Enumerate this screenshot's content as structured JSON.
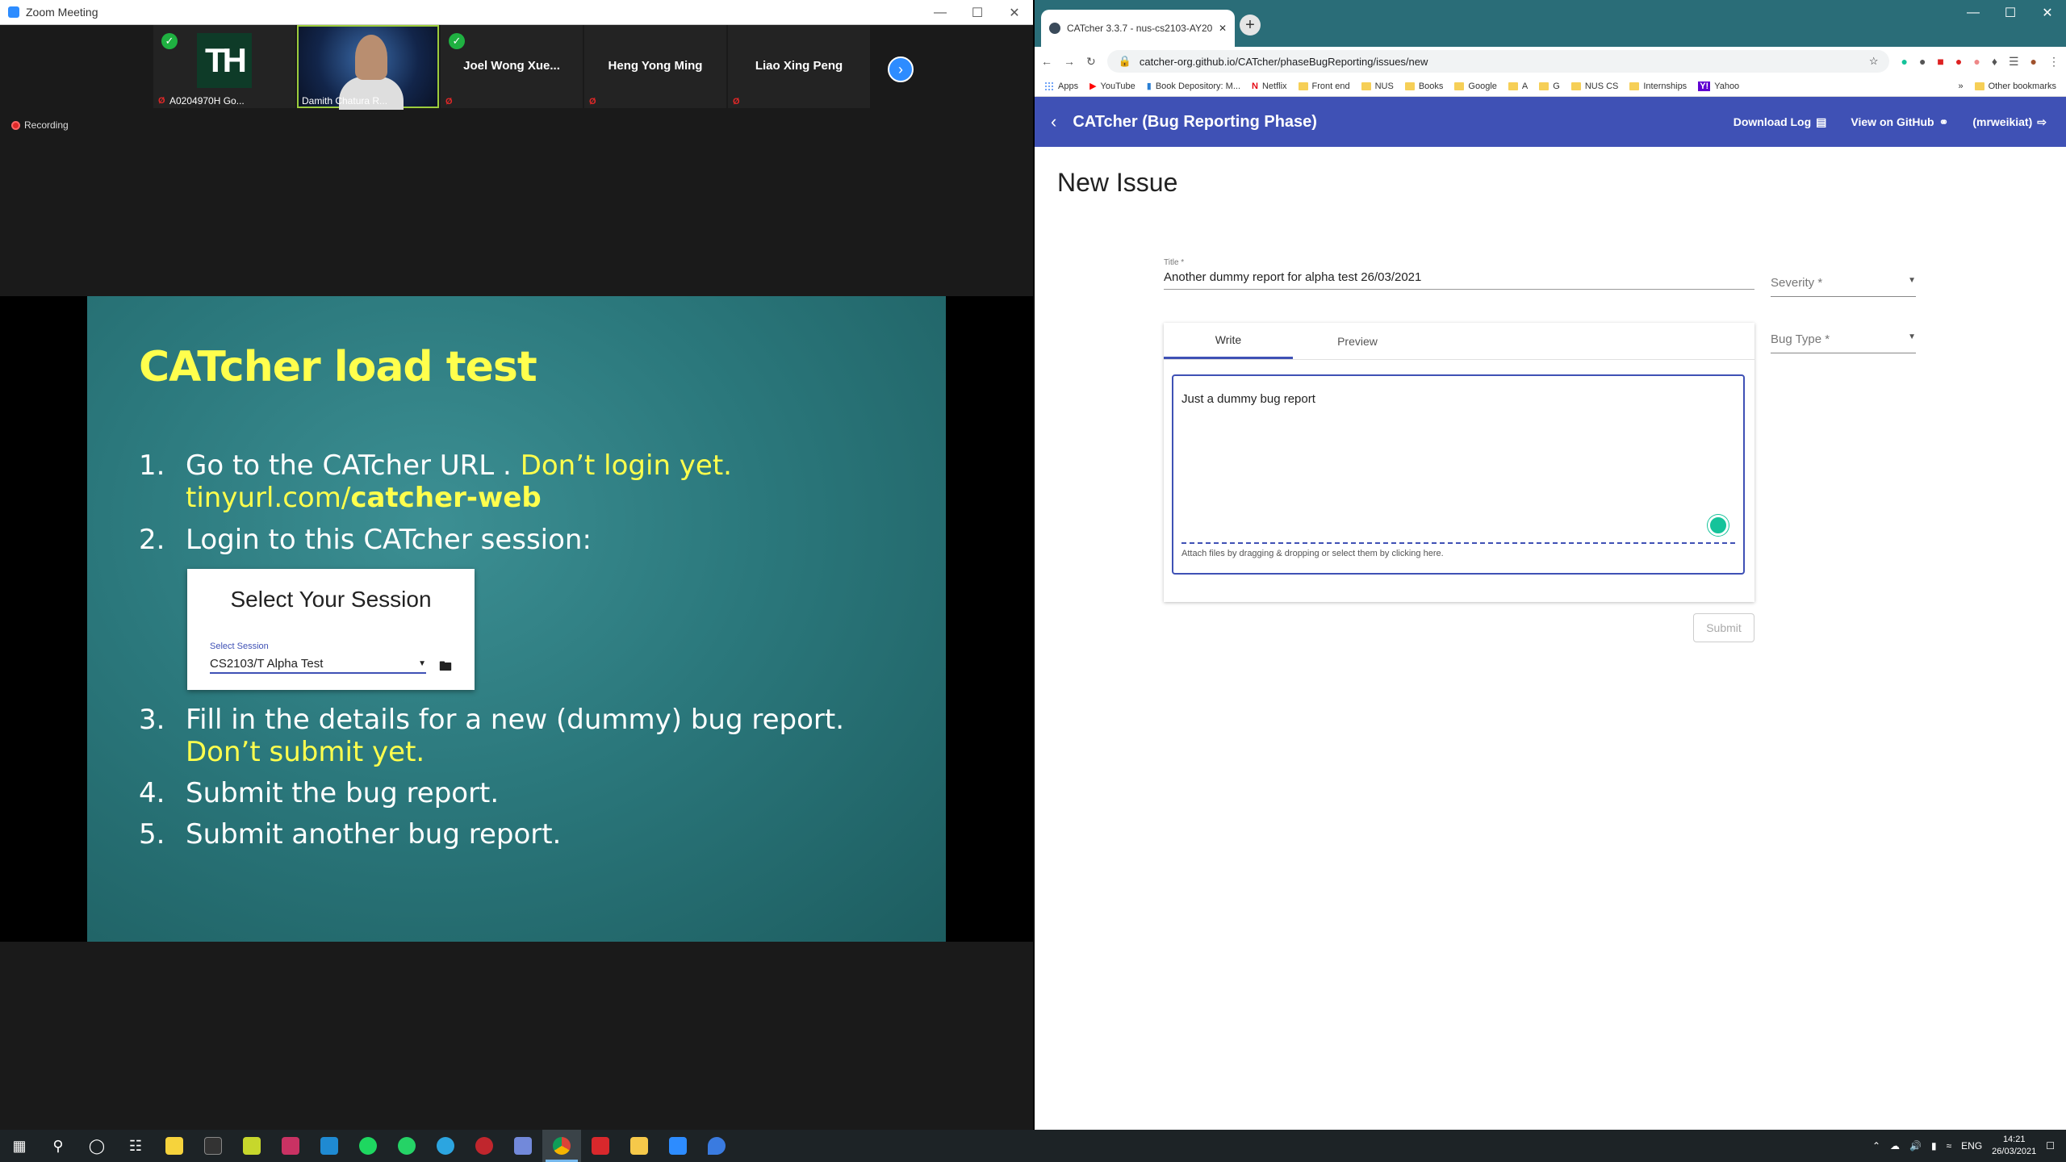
{
  "zoom": {
    "title": "Zoom Meeting",
    "recording_label": "Recording",
    "participants": [
      {
        "name": "",
        "label": "A0204970H Go...",
        "avatar_text": "TH"
      },
      {
        "name": "",
        "label": "Damith Chatura R..."
      },
      {
        "name": "Joel Wong Xue...",
        "label": ""
      },
      {
        "name": "Heng Yong Ming",
        "label": ""
      },
      {
        "name": "Liao Xing Peng",
        "label": ""
      }
    ],
    "next_icon": "chevron-right-icon"
  },
  "slide": {
    "title": "CATcher load test",
    "items": [
      {
        "num": "1.",
        "text": "Go to the CATcher URL . ",
        "highlight": "Don’t login yet.",
        "line2_plain": "tinyurl.com/",
        "line2_bold": "catcher-web"
      },
      {
        "num": "2.",
        "text": "Login to this CATcher session:"
      },
      {
        "num": "3.",
        "text": "Fill in the details for a new (dummy) bug report.",
        "line2": "Don’t submit yet."
      },
      {
        "num": "4.",
        "text": "Submit the bug report."
      },
      {
        "num": "5.",
        "text": "Submit another bug report."
      }
    ],
    "session_card": {
      "heading": "Select Your Session",
      "label": "Select Session",
      "value": "CS2103/T Alpha Test"
    }
  },
  "browser": {
    "tab_title": "CATcher 3.3.7 - nus-cs2103-AY20",
    "url": "catcher-org.github.io/CATcher/phaseBugReporting/issues/new",
    "bookmarks": [
      "Apps",
      "YouTube",
      "Book Depository: M...",
      "Netflix",
      "Front end",
      "NUS",
      "Books",
      "Google",
      "A",
      "G",
      "NUS CS",
      "Internships",
      "Yahoo"
    ],
    "other_bookmarks": "Other bookmarks"
  },
  "app": {
    "title": "CATcher  (Bug Reporting Phase)",
    "download_log": "Download Log",
    "view_on_github": "View on GitHub",
    "user": "(mrweikiat)",
    "accent_color": "#3f51b5",
    "page_title": "New Issue",
    "form": {
      "title_label": "Title *",
      "title_value": "Another dummy report for alpha test 26/03/2021",
      "severity_placeholder": "Severity *",
      "bug_type_placeholder": "Bug Type *",
      "tab_write": "Write",
      "tab_preview": "Preview",
      "description": "Just a dummy bug report",
      "attach_hint": "Attach files by dragging & dropping or select them by clicking here.",
      "submit_label": "Submit"
    }
  },
  "taskbar": {
    "lang": "ENG",
    "time": "14:21",
    "date": "26/03/2021"
  }
}
